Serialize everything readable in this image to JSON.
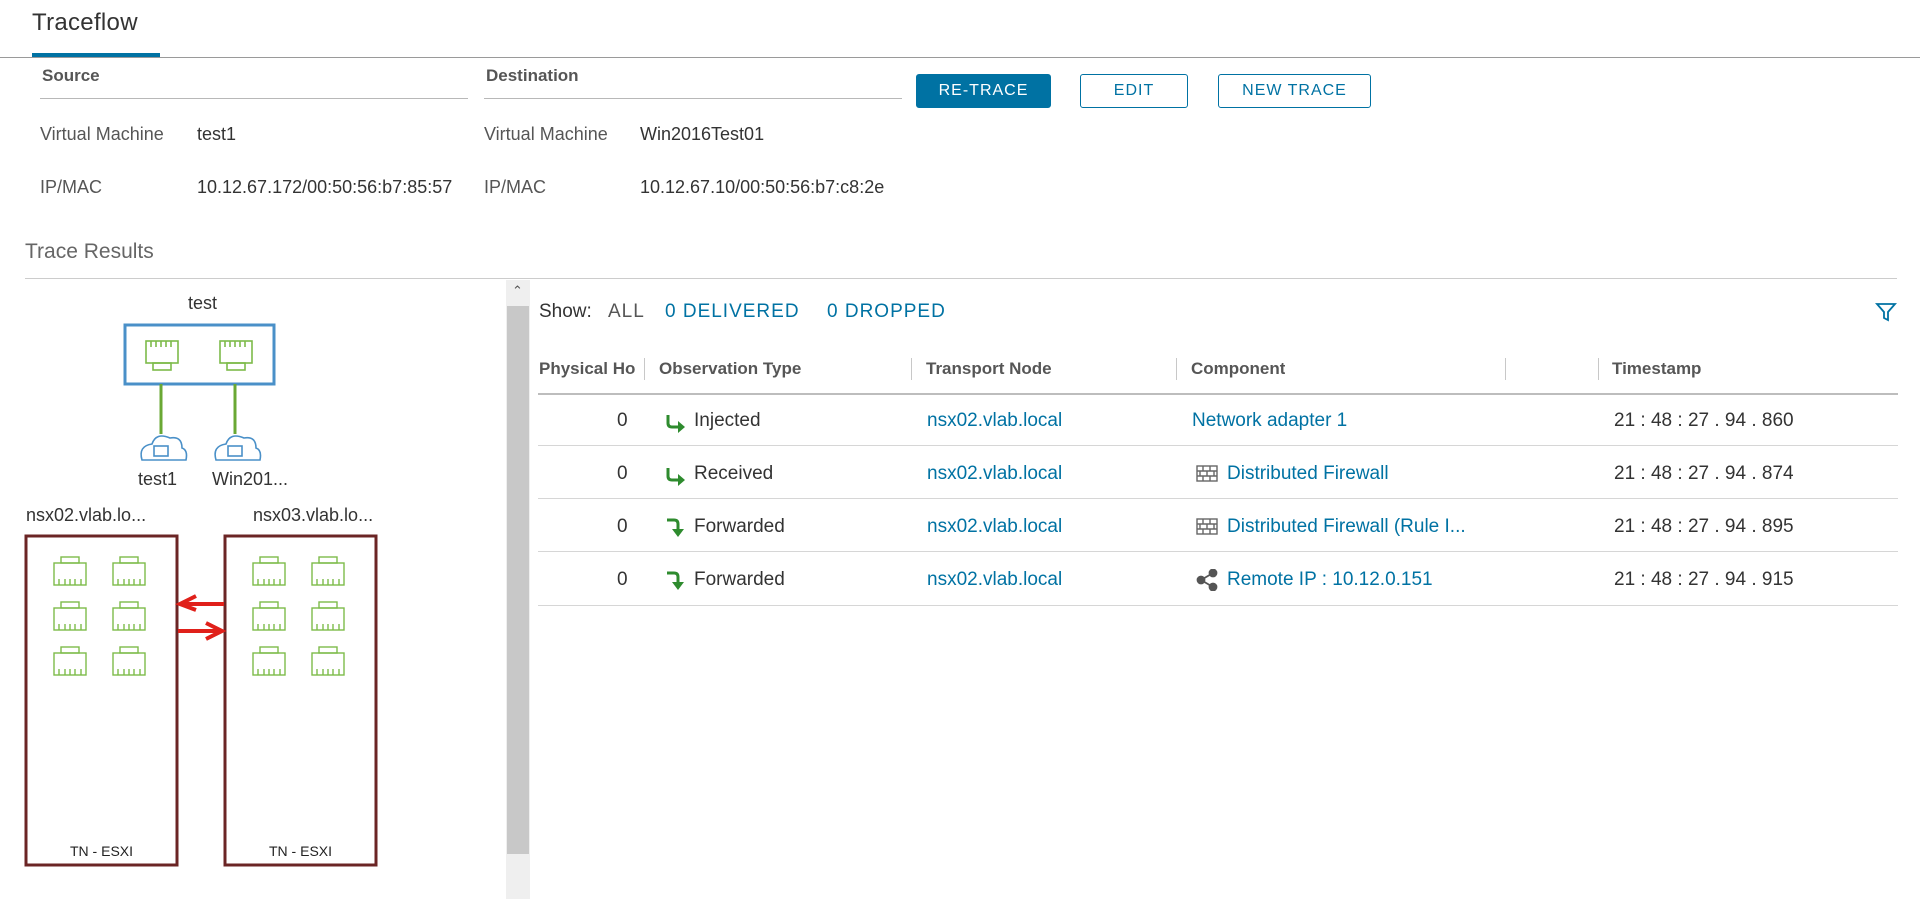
{
  "tab": {
    "title": "Traceflow"
  },
  "source": {
    "heading": "Source",
    "vm_label": "Virtual Machine",
    "vm_value": "test1",
    "ipmac_label": "IP/MAC",
    "ipmac_value": "10.12.67.172/00:50:56:b7:85:57"
  },
  "destination": {
    "heading": "Destination",
    "vm_label": "Virtual Machine",
    "vm_value": "Win2016Test01",
    "ipmac_label": "IP/MAC",
    "ipmac_value": "10.12.67.10/00:50:56:b7:c8:2e"
  },
  "actions": {
    "retrace": "RE-TRACE",
    "edit": "EDIT",
    "new_trace": "NEW TRACE"
  },
  "trace_results": {
    "title": "Trace Results"
  },
  "topology": {
    "segment_label": "test",
    "vm1_label": "test1",
    "vm2_label": "Win201...",
    "host1_label": "nsx02.vlab.lo...",
    "host2_label": "nsx03.vlab.lo...",
    "host1_type": "TN - ESXI",
    "host2_type": "TN - ESXI",
    "colors": {
      "segment": "#4a90c8",
      "host": "#6b2525",
      "arrow": "#e0201a",
      "port": "#7dbb4a",
      "link": "#6aa834"
    }
  },
  "filters": {
    "show_label": "Show:",
    "all": "ALL",
    "delivered": "0 DELIVERED",
    "dropped": "0 DROPPED"
  },
  "table": {
    "headers": [
      "Physical Ho",
      "Observation Type",
      "Transport Node",
      "Component",
      "",
      "Timestamp"
    ],
    "rows": [
      {
        "hop": "0",
        "obs": "Injected",
        "obs_icon": "arrow-turn-right-icon",
        "node": "nsx02.vlab.local",
        "component": "Network adapter 1",
        "comp_icon": "",
        "timestamp": "21 : 48 : 27 . 94 . 860"
      },
      {
        "hop": "0",
        "obs": "Received",
        "obs_icon": "arrow-turn-right-icon",
        "node": "nsx02.vlab.local",
        "component": "Distributed Firewall",
        "comp_icon": "firewall-icon",
        "timestamp": "21 : 48 : 27 . 94 . 874"
      },
      {
        "hop": "0",
        "obs": "Forwarded",
        "obs_icon": "arrow-turn-down-icon",
        "node": "nsx02.vlab.local",
        "component": "Distributed Firewall (Rule I...",
        "comp_icon": "firewall-icon",
        "timestamp": "21 : 48 : 27 . 94 . 895"
      },
      {
        "hop": "0",
        "obs": "Forwarded",
        "obs_icon": "arrow-turn-down-icon",
        "node": "nsx02.vlab.local",
        "component": "Remote IP : 10.12.0.151",
        "comp_icon": "share-icon",
        "timestamp": "21 : 48 : 27 . 94 . 915"
      }
    ]
  },
  "colors": {
    "accent": "#0072a3",
    "success": "#2e8b2e"
  }
}
